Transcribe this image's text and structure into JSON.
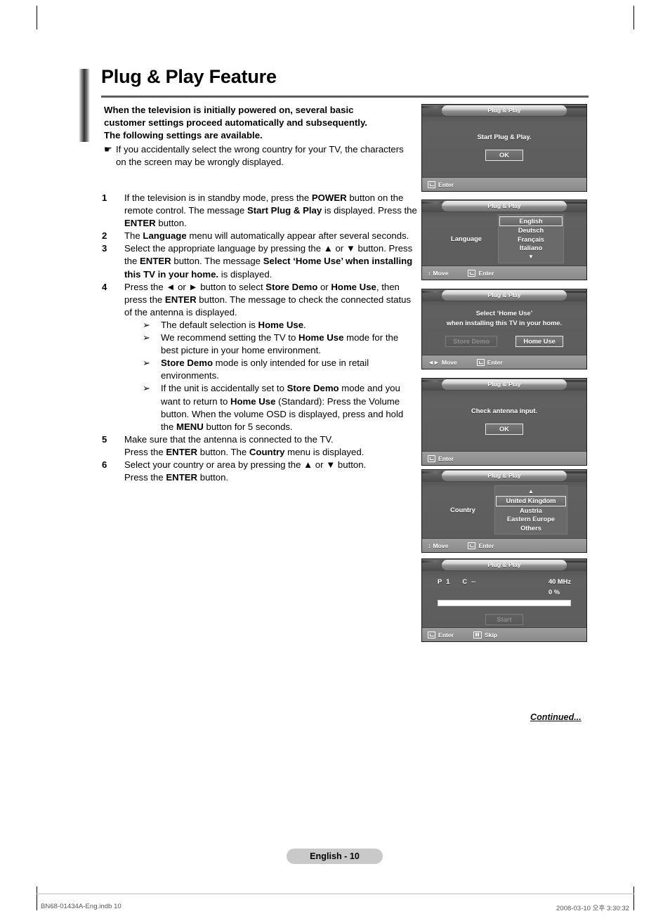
{
  "page": {
    "title": "Plug & Play Feature",
    "page_label": "English - 10",
    "continued": "Continued...",
    "print_footer_left": "BN68-01434A-Eng.indb   10",
    "print_footer_right": "2008-03-10   오후 3:30:32"
  },
  "intro": {
    "lead_line1": "When the television is initially powered on, several basic",
    "lead_line2": "customer settings proceed automatically and subsequently.",
    "lead_line3": "The following settings are available.",
    "hand_icon": "☛",
    "note": "If you accidentally select the wrong country for your TV, the characters on the screen may be wrongly displayed."
  },
  "steps": [
    {
      "number": "1",
      "parts": [
        {
          "t": "If the television is in standby mode, press the ",
          "b": false
        },
        {
          "t": "POWER",
          "b": true
        },
        {
          "t": " button on the remote control. The message ",
          "b": false
        },
        {
          "t": "Start Plug & Play",
          "b": true
        },
        {
          "t": " is displayed. Press the ",
          "b": false
        },
        {
          "t": "ENTER",
          "b": true
        },
        {
          "t": " button.",
          "b": false
        }
      ]
    },
    {
      "number": "2",
      "parts": [
        {
          "t": "The ",
          "b": false
        },
        {
          "t": "Language",
          "b": true
        },
        {
          "t": " menu will automatically appear after several seconds.",
          "b": false
        }
      ]
    },
    {
      "number": "3",
      "parts": [
        {
          "t": "Select the appropriate language by pressing the ▲ or ▼  button. Press the ",
          "b": false
        },
        {
          "t": "ENTER",
          "b": true
        },
        {
          "t": " button. The message ",
          "b": false
        },
        {
          "t": "Select ‘Home Use’ when installing this TV in your home.",
          "b": true
        },
        {
          "t": " is displayed.",
          "b": false
        }
      ]
    },
    {
      "number": "4",
      "parts": [
        {
          "t": "Press the ◄ or ► button to select ",
          "b": false
        },
        {
          "t": "Store Demo",
          "b": true
        },
        {
          "t": " or ",
          "b": false
        },
        {
          "t": "Home Use",
          "b": true
        },
        {
          "t": ", then press the ",
          "b": false
        },
        {
          "t": "ENTER",
          "b": true
        },
        {
          "t": " button. The message to check the connected status of the antenna is displayed.",
          "b": false
        }
      ],
      "subnotes": [
        [
          {
            "t": "The default selection is ",
            "b": false
          },
          {
            "t": "Home Use",
            "b": true
          },
          {
            "t": ".",
            "b": false
          }
        ],
        [
          {
            "t": "We recommend setting the TV to ",
            "b": false
          },
          {
            "t": "Home Use",
            "b": true
          },
          {
            "t": " mode for the best picture in your home environment.",
            "b": false
          }
        ],
        [
          {
            "t": "Store Demo",
            "b": true
          },
          {
            "t": " mode is only intended for use in retail environments.",
            "b": false
          }
        ],
        [
          {
            "t": "If the unit is accidentally set to ",
            "b": false
          },
          {
            "t": "Store Demo",
            "b": true
          },
          {
            "t": " mode and you want to return to ",
            "b": false
          },
          {
            "t": "Home Use",
            "b": true
          },
          {
            "t": " (Standard): Press the Volume button. When the volume OSD is displayed, press and hold the ",
            "b": false
          },
          {
            "t": "MENU",
            "b": true
          },
          {
            "t": " button for 5 seconds.",
            "b": false
          }
        ]
      ]
    },
    {
      "number": "5",
      "parts": [
        {
          "t": "Make sure that the antenna is connected to the TV.",
          "b": false
        },
        {
          "t": "\n",
          "b": false
        },
        {
          "t": "Press the ",
          "b": false
        },
        {
          "t": "ENTER",
          "b": true
        },
        {
          "t": " button. The ",
          "b": false
        },
        {
          "t": "Country",
          "b": true
        },
        {
          "t": " menu is displayed.",
          "b": false
        }
      ]
    },
    {
      "number": "6",
      "parts": [
        {
          "t": "Select your country or area by pressing the ▲ or ▼ button.",
          "b": false
        },
        {
          "t": "\n",
          "b": false
        },
        {
          "t": "Press the ",
          "b": false
        },
        {
          "t": "ENTER",
          "b": true
        },
        {
          "t": " button.",
          "b": false
        }
      ]
    }
  ],
  "subnote_icon": "➢",
  "osd_panels": [
    {
      "id": "start",
      "title": "Plug & Play",
      "message": "Start Plug & Play.",
      "button": "OK",
      "footer": [
        {
          "icon": "enter-key-icon",
          "label": "Enter"
        }
      ]
    },
    {
      "id": "language",
      "title": "Plug & Play",
      "row_label": "Language",
      "options": [
        "English",
        "Deutsch",
        "Français",
        "Italiano"
      ],
      "selected": "English",
      "scroll_down_arrow": "▼",
      "footer": [
        {
          "icon": "updown-arrows-icon",
          "label": "Move"
        },
        {
          "icon": "enter-key-icon",
          "label": "Enter"
        }
      ]
    },
    {
      "id": "home-use",
      "title": "Plug & Play",
      "message_line1": "Select ‘Home Use’",
      "message_line2": "when installing this TV in your home.",
      "button_left": "Store Demo",
      "button_right": "Home Use",
      "selected": "Home Use",
      "footer": [
        {
          "icon": "leftright-arrows-icon",
          "label": "Move"
        },
        {
          "icon": "enter-key-icon",
          "label": "Enter"
        }
      ]
    },
    {
      "id": "antenna",
      "title": "Plug & Play",
      "message": "Check antenna input.",
      "button": "OK",
      "footer": [
        {
          "icon": "enter-key-icon",
          "label": "Enter"
        }
      ]
    },
    {
      "id": "country",
      "title": "Plug & Play",
      "row_label": "Country",
      "scroll_up_arrow": "▲",
      "options": [
        "United Kingdom",
        "Austria",
        "Eastern Europe",
        "Others"
      ],
      "selected": "United Kingdom",
      "footer": [
        {
          "icon": "updown-arrows-icon",
          "label": "Move"
        },
        {
          "icon": "enter-key-icon",
          "label": "Enter"
        }
      ]
    },
    {
      "id": "scan",
      "title": "Plug & Play",
      "program_label": "P",
      "program_value": "1",
      "channel_label": "C",
      "channel_value": "--",
      "frequency": "40 MHz",
      "percent": "0  %",
      "progress": 0,
      "button": "Start",
      "footer": [
        {
          "icon": "enter-key-icon",
          "label": "Enter"
        },
        {
          "icon": "menu-key-icon",
          "label": "Skip"
        }
      ]
    }
  ]
}
